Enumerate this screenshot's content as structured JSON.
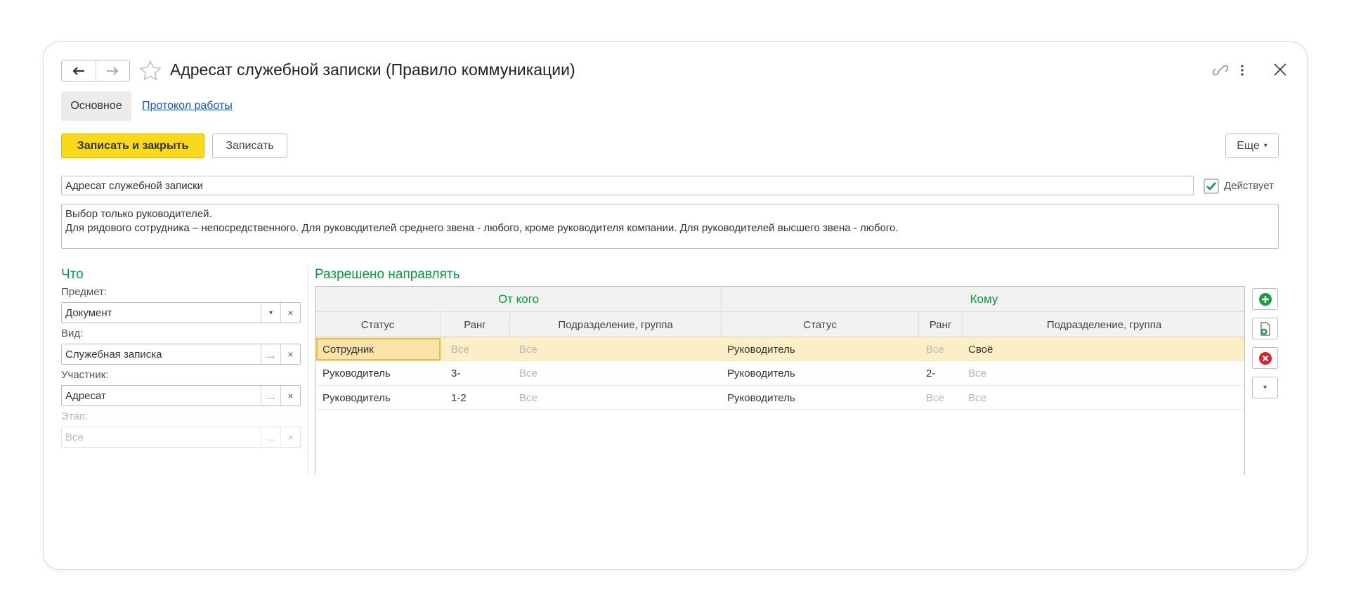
{
  "window": {
    "title": "Адресат служебной записки (Правило коммуникации)"
  },
  "tabs": [
    {
      "label": "Основное",
      "active": true
    },
    {
      "label": "Протокол работы",
      "active": false
    }
  ],
  "toolbar": {
    "save_close_label": "Записать и закрыть",
    "save_label": "Записать",
    "more_label": "Еще"
  },
  "form": {
    "name_value": "Адресат служебной записки",
    "active_label": "Действует",
    "active_checked": true,
    "description_line1": "Выбор только руководителей.",
    "description_line2": "Для рядового сотрудника – непосредственного. Для руководителей среднего звена - любого, кроме руководителя компании. Для руководителей высшего звена - любого."
  },
  "what": {
    "title": "Что",
    "subject_label": "Предмет:",
    "subject_value": "Документ",
    "kind_label": "Вид:",
    "kind_value": "Служебная записка",
    "participant_label": "Участник:",
    "participant_value": "Адресат",
    "stage_label": "Этап:",
    "stage_value": "Все"
  },
  "allowed": {
    "title": "Разрешено направлять",
    "from_group": "От кого",
    "to_group": "Кому",
    "columns": [
      "Статус",
      "Ранг",
      "Подразделение, группа",
      "Статус",
      "Ранг",
      "Подразделение, группа"
    ],
    "rows": [
      {
        "from_status": "Сотрудник",
        "from_rank": "Все",
        "from_dept": "Все",
        "to_status": "Руководитель",
        "to_rank": "Все",
        "to_dept": "Своё",
        "selected": true
      },
      {
        "from_status": "Руководитель",
        "from_rank": "3-",
        "from_dept": "Все",
        "to_status": "Руководитель",
        "to_rank": "2-",
        "to_dept": "Все",
        "selected": false
      },
      {
        "from_status": "Руководитель",
        "from_rank": "1-2",
        "from_dept": "Все",
        "to_status": "Руководитель",
        "to_rank": "Все",
        "to_dept": "Все",
        "selected": false
      }
    ]
  },
  "colors": {
    "accent_green": "#0b9a44",
    "primary_yellow": "#f9d91b",
    "selected_row": "#fcefc5",
    "link_blue": "#1a56c8",
    "delete_red": "#d9222a"
  },
  "glyphs": {
    "ellipsis": "...",
    "clear": "×",
    "dropdown": "▾"
  }
}
